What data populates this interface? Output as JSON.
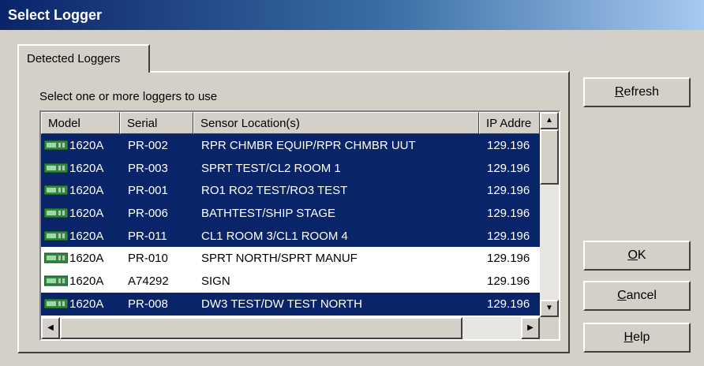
{
  "window": {
    "title": "Select Logger"
  },
  "tab": {
    "label": "Detected Loggers"
  },
  "instruction": "Select one or more loggers to use",
  "columns": [
    "Model",
    "Serial",
    "Sensor Location(s)",
    "IP Addre"
  ],
  "rows": [
    {
      "model": "1620A",
      "serial": "PR-002",
      "location": "RPR CHMBR EQUIP/RPR CHMBR UUT",
      "ip": "129.196",
      "selected": true
    },
    {
      "model": "1620A",
      "serial": "PR-003",
      "location": "SPRT TEST/CL2 ROOM 1",
      "ip": "129.196",
      "selected": true
    },
    {
      "model": "1620A",
      "serial": "PR-001",
      "location": "RO1 RO2 TEST/RO3 TEST",
      "ip": "129.196",
      "selected": true
    },
    {
      "model": "1620A",
      "serial": "PR-006",
      "location": "BATHTEST/SHIP STAGE",
      "ip": "129.196",
      "selected": true
    },
    {
      "model": "1620A",
      "serial": "PR-011",
      "location": "CL1 ROOM 3/CL1 ROOM 4",
      "ip": "129.196",
      "selected": true
    },
    {
      "model": "1620A",
      "serial": "PR-010",
      "location": "SPRT NORTH/SPRT MANUF",
      "ip": "129.196",
      "selected": false
    },
    {
      "model": "1620A",
      "serial": "A74292",
      "location": "SIGN",
      "ip": "129.196",
      "selected": false
    },
    {
      "model": "1620A",
      "serial": "PR-008",
      "location": "DW3 TEST/DW TEST NORTH",
      "ip": "129.196",
      "selected": true
    }
  ],
  "buttons": {
    "refresh": {
      "mnemonic": "R",
      "rest": "efresh"
    },
    "ok": {
      "mnemonic": "O",
      "rest": "K"
    },
    "cancel": {
      "mnemonic": "C",
      "rest": "ancel"
    },
    "help": {
      "mnemonic": "H",
      "rest": "elp"
    }
  },
  "colors": {
    "selection": "#0a246a",
    "title_start": "#0a246a",
    "title_end": "#a6caf0"
  },
  "icons": {
    "row_icon": "logger-device-icon"
  }
}
